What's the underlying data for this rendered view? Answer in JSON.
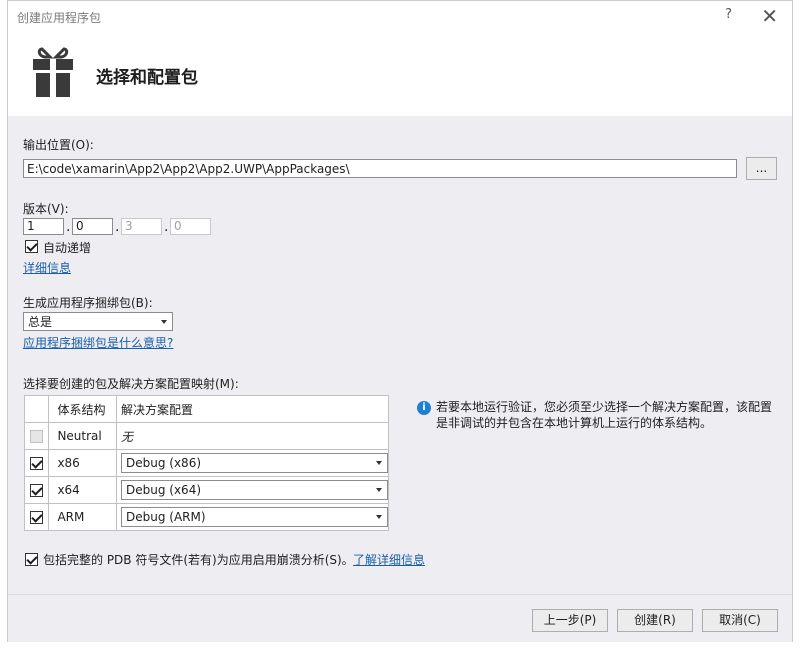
{
  "window": {
    "title": "创建应用程序包",
    "help": "?",
    "close": "✕"
  },
  "header": {
    "title": "选择和配置包",
    "icon": "gift-package-icon"
  },
  "output": {
    "label": "输出位置(O):",
    "path": "E:\\code\\xamarin\\App2\\App2\\App2.UWP\\AppPackages\\",
    "browse_label": "..."
  },
  "version": {
    "label": "版本(V):",
    "major": "1",
    "minor": "0",
    "build": "3",
    "revision": "0",
    "auto_increment_label": "自动递增",
    "auto_increment_checked": true,
    "details_link": "详细信息"
  },
  "bundle": {
    "label": "生成应用程序捆绑包(B):",
    "selected": "总是",
    "help_link": "应用程序捆绑包是什么意思?"
  },
  "mapping": {
    "label": "选择要创建的包及解决方案配置映射(M):",
    "col_arch": "体系结构",
    "col_config": "解决方案配置",
    "rows": [
      {
        "arch": "Neutral",
        "config": "无",
        "checked": false,
        "enabled": false
      },
      {
        "arch": "x86",
        "config": "Debug (x86)",
        "checked": true,
        "enabled": true
      },
      {
        "arch": "x64",
        "config": "Debug (x64)",
        "checked": true,
        "enabled": true
      },
      {
        "arch": "ARM",
        "config": "Debug (ARM)",
        "checked": true,
        "enabled": true
      }
    ]
  },
  "info": {
    "icon": "info-icon",
    "text": "若要本地运行验证，您必须至少选择一个解决方案配置，该配置是非调试的并包含在本地计算机上运行的体系结构。"
  },
  "pdb": {
    "label": "包括完整的 PDB 符号文件(若有)为应用启用崩溃分析(S)。",
    "checked": true,
    "link": "了解详细信息"
  },
  "buttons": {
    "back": "上一步(P)",
    "create": "创建(R)",
    "cancel": "取消(C)"
  }
}
